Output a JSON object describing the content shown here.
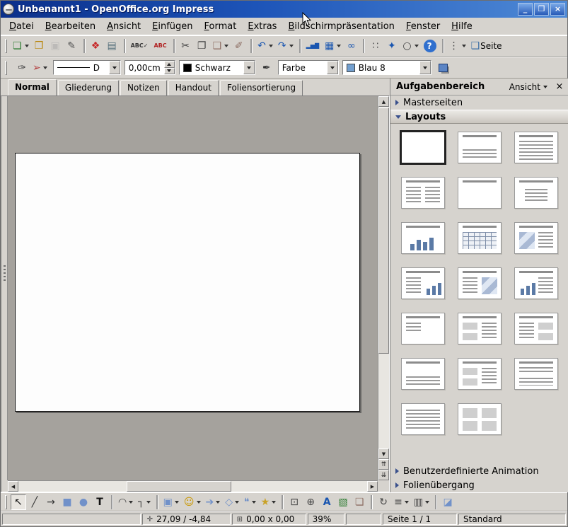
{
  "titlebar": {
    "title": "Unbenannt1 - OpenOffice.org Impress",
    "buttons": [
      {
        "name": "minimize-button",
        "glyph": "_"
      },
      {
        "name": "maximize-button",
        "glyph": "❐"
      },
      {
        "name": "close-button",
        "glyph": "×"
      }
    ]
  },
  "menubar": {
    "items": [
      {
        "name": "menu-datei",
        "label": "Datei"
      },
      {
        "name": "menu-bearbeiten",
        "label": "Bearbeiten"
      },
      {
        "name": "menu-ansicht",
        "label": "Ansicht"
      },
      {
        "name": "menu-einfuegen",
        "label": "Einfügen"
      },
      {
        "name": "menu-format",
        "label": "Format"
      },
      {
        "name": "menu-extras",
        "label": "Extras"
      },
      {
        "name": "menu-bildschirmpraesentation",
        "label": "Bildschirmpräsentation"
      },
      {
        "name": "menu-fenster",
        "label": "Fenster"
      },
      {
        "name": "menu-hilfe",
        "label": "Hilfe"
      }
    ]
  },
  "toolbar_standard": {
    "icons": [
      {
        "name": "new-document-button",
        "glyph": "❏",
        "color": "#2e7d32",
        "dropdown": true
      },
      {
        "name": "open-button",
        "glyph": "❒",
        "color": "#b8860b"
      },
      {
        "name": "save-button",
        "glyph": "▣",
        "color": "#9e9e9e",
        "disabled": true
      },
      {
        "name": "edit-file-button",
        "glyph": "✎",
        "color": "#555555"
      },
      {
        "sep": true
      },
      {
        "name": "export-pdf-button",
        "glyph": "❖",
        "color": "#c62828"
      },
      {
        "name": "print-button",
        "glyph": "▤",
        "color": "#546e7a"
      },
      {
        "sep": true
      },
      {
        "name": "spellcheck-button",
        "glyph": "ABC✓",
        "color": "#333333",
        "small": true
      },
      {
        "name": "autospellcheck-button",
        "glyph": "ABC",
        "color": "#b02020",
        "small": true
      },
      {
        "sep": true
      },
      {
        "name": "cut-button",
        "glyph": "✂",
        "color": "#444444"
      },
      {
        "name": "copy-button",
        "glyph": "❐",
        "color": "#444444"
      },
      {
        "name": "paste-button",
        "glyph": "❑",
        "color": "#8d6e63",
        "dropdown": true
      },
      {
        "name": "format-paintbrush-button",
        "glyph": "✐",
        "color": "#8d6e63"
      },
      {
        "sep": true
      },
      {
        "name": "undo-button",
        "glyph": "↶",
        "color": "#1a56b0",
        "dropdown": true
      },
      {
        "name": "redo-button",
        "glyph": "↷",
        "color": "#1a56b0",
        "dropdown": true
      },
      {
        "sep": true
      },
      {
        "name": "chart-button",
        "glyph": "▂▅▇",
        "color": "#1a56b0",
        "small": true
      },
      {
        "name": "table-button",
        "glyph": "▦",
        "color": "#1a56b0",
        "dropdown": true
      },
      {
        "name": "hyperlink-button",
        "glyph": "∞",
        "color": "#1a56b0"
      },
      {
        "sep": true
      },
      {
        "name": "grid-button",
        "glyph": "∷",
        "color": "#555555"
      },
      {
        "name": "navigator-button",
        "glyph": "✦",
        "color": "#1a56b0"
      },
      {
        "name": "zoom-button",
        "glyph": "○",
        "color": "#444444",
        "dropdown": true
      },
      {
        "name": "help-button",
        "glyph": "?",
        "color": "#ffffff",
        "bg": "#2f6fce"
      },
      {
        "sep": true
      },
      {
        "name": "toolbar-options-button",
        "glyph": "⋮",
        "color": "#444444",
        "dropdown": true
      },
      {
        "name": "page-button",
        "glyph": "❑",
        "color": "#3a6ea5",
        "label": "Seite"
      }
    ]
  },
  "toolbar_line": {
    "tools": [
      {
        "name": "edit-points-button",
        "glyph": "✑",
        "color": "#444444"
      },
      {
        "name": "arrow-style-button",
        "glyph": "➢",
        "color": "#b23b3b",
        "dropdown": true
      }
    ],
    "line_style_label": "D",
    "line_width_value": "0,00cm",
    "line_color_label": "Schwarz",
    "line_color_hex": "#000000",
    "fill_tool_glyph": "✒",
    "fill_type_label": "Farbe",
    "fill_color_label": "Blau 8",
    "fill_color_hex": "#729fcf"
  },
  "view_tabs": {
    "items": [
      {
        "name": "tab-normal",
        "label": "Normal",
        "active": true
      },
      {
        "name": "tab-gliederung",
        "label": "Gliederung"
      },
      {
        "name": "tab-notizen",
        "label": "Notizen"
      },
      {
        "name": "tab-handout",
        "label": "Handout"
      },
      {
        "name": "tab-foliensortierung",
        "label": "Foliensortierung"
      }
    ]
  },
  "scrollbars": {
    "up": "▲",
    "down": "▼",
    "left": "◀",
    "right": "▶",
    "prev_slide": "⇈",
    "next_slide": "⇊"
  },
  "task_panel": {
    "title": "Aufgabenbereich",
    "view_label": "Ansicht",
    "close_glyph": "×",
    "sections": [
      {
        "name": "section-masterseiten",
        "label": "Masterseiten",
        "expanded": false
      },
      {
        "name": "section-layouts",
        "label": "Layouts",
        "expanded": true,
        "selected": true
      },
      {
        "name": "section-benutzerdefinierte-animation",
        "label": "Benutzerdefinierte Animation",
        "expanded": false
      },
      {
        "name": "section-folienuebergang",
        "label": "Folienübergang",
        "expanded": false
      }
    ],
    "layouts": [
      {
        "name": "layout-blank",
        "pattern": "blank",
        "selected": true
      },
      {
        "name": "layout-title-text",
        "pattern": "title-text"
      },
      {
        "name": "layout-title-list",
        "pattern": "title-list"
      },
      {
        "name": "layout-two-lists",
        "pattern": "two-lists"
      },
      {
        "name": "layout-title-only",
        "pattern": "title-only"
      },
      {
        "name": "layout-centered-text",
        "pattern": "center-text"
      },
      {
        "name": "layout-title-chart",
        "pattern": "chart"
      },
      {
        "name": "layout-title-table",
        "pattern": "table"
      },
      {
        "name": "layout-clipart-text",
        "pattern": "image-list"
      },
      {
        "name": "layout-text-chart",
        "pattern": "list-chart"
      },
      {
        "name": "layout-text-clipart",
        "pattern": "list-image"
      },
      {
        "name": "layout-chart-text",
        "pattern": "chart-list"
      },
      {
        "name": "layout-text",
        "pattern": "quarter-lines"
      },
      {
        "name": "layout-two-content-text",
        "pattern": "rows-left-list-right"
      },
      {
        "name": "layout-text-two-content",
        "pattern": "list-left-rows-right"
      },
      {
        "name": "layout-text-over-text",
        "pattern": "lines-bottom"
      },
      {
        "name": "layout-two-content-over-text",
        "pattern": "rows-left-list-right"
      },
      {
        "name": "layout-content-over-text",
        "pattern": "list-lines-bottom"
      },
      {
        "name": "layout-text-only",
        "pattern": "text-lines"
      },
      {
        "name": "layout-four-content",
        "pattern": "four-blocks"
      }
    ]
  },
  "drawbar": {
    "icons": [
      {
        "name": "select-tool",
        "glyph": "↖",
        "color": "#111111",
        "active": true
      },
      {
        "name": "line-tool",
        "glyph": "╱",
        "color": "#333333"
      },
      {
        "name": "arrow-tool",
        "glyph": "→",
        "color": "#333333"
      },
      {
        "name": "rectangle-tool",
        "glyph": "■",
        "color": "#7191c9"
      },
      {
        "name": "ellipse-tool",
        "glyph": "●",
        "color": "#7191c9"
      },
      {
        "name": "text-tool",
        "glyph": "T",
        "color": "#111111",
        "bold": true
      },
      {
        "sep": true
      },
      {
        "name": "curve-tool",
        "glyph": "◠",
        "color": "#444444",
        "dropdown": true
      },
      {
        "name": "connector-tool",
        "glyph": "┐",
        "color": "#444444",
        "dropdown": true
      },
      {
        "sep": true
      },
      {
        "name": "basic-shapes-tool",
        "glyph": "▣",
        "color": "#7191c9",
        "dropdown": true
      },
      {
        "name": "symbol-shapes-tool",
        "glyph": "☺",
        "color": "#c99700",
        "dropdown": true
      },
      {
        "name": "block-arrows-tool",
        "glyph": "➔",
        "color": "#7191c9",
        "dropdown": true
      },
      {
        "name": "flowchart-tool",
        "glyph": "◇",
        "color": "#7191c9",
        "dropdown": true
      },
      {
        "name": "callouts-tool",
        "glyph": "❝",
        "color": "#7191c9",
        "dropdown": true
      },
      {
        "name": "stars-tool",
        "glyph": "★",
        "color": "#c9a227",
        "dropdown": true
      },
      {
        "sep": true
      },
      {
        "name": "edit-points-tool",
        "glyph": "⊡",
        "color": "#444444"
      },
      {
        "name": "glue-points-tool",
        "glyph": "⊕",
        "color": "#444444"
      },
      {
        "name": "fontwork-tool",
        "glyph": "A",
        "color": "#1a56b0",
        "bold": true
      },
      {
        "name": "from-file-tool",
        "glyph": "▧",
        "color": "#2e7d32"
      },
      {
        "name": "gallery-tool",
        "glyph": "❏",
        "color": "#8d6e63"
      },
      {
        "sep": true
      },
      {
        "name": "rotate-tool",
        "glyph": "↻",
        "color": "#444444"
      },
      {
        "name": "align-tool",
        "glyph": "≡",
        "color": "#444444",
        "dropdown": true
      },
      {
        "name": "arrange-tool",
        "glyph": "▥",
        "color": "#444444",
        "dropdown": true
      },
      {
        "sep": true
      },
      {
        "name": "extrusion-tool",
        "glyph": "◪",
        "color": "#7191c9"
      }
    ]
  },
  "statusbar": {
    "position_icon": "✛",
    "position_label": "27,09 / -4,84",
    "size_icon": "⊞",
    "size_label": "0,00 x 0,00",
    "zoom_label": "39%",
    "page_label": "Seite 1 / 1",
    "style_label": "Standard"
  }
}
